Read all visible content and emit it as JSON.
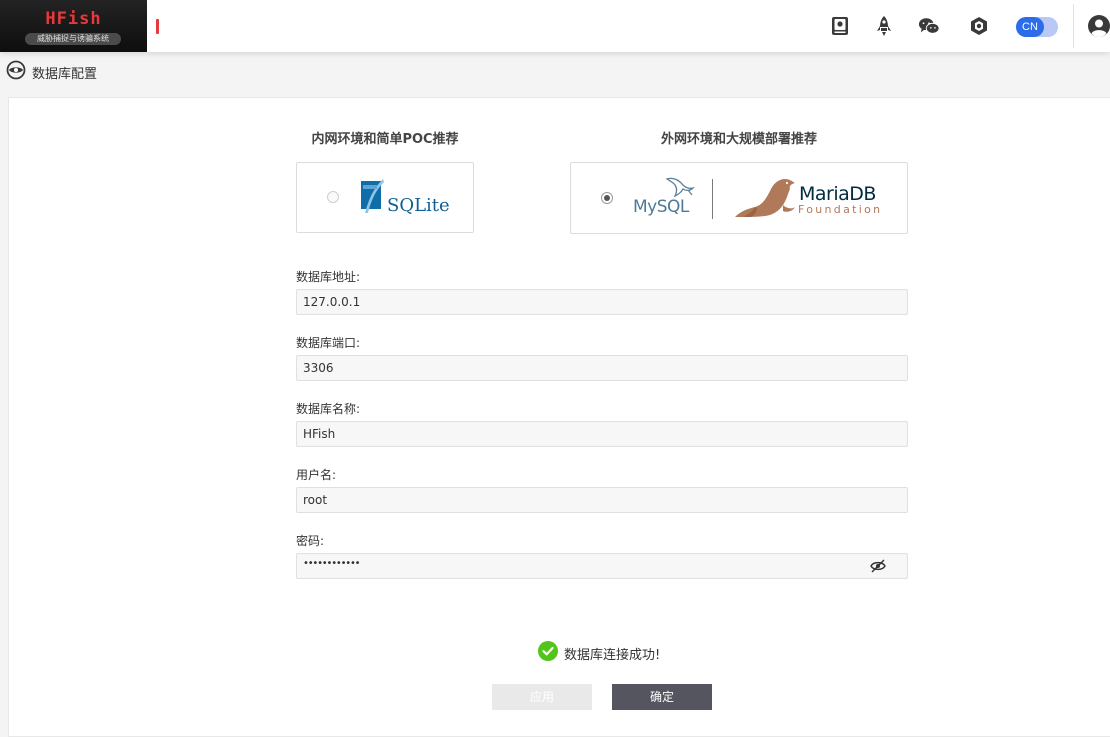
{
  "app": {
    "logo_title": "HFish",
    "logo_subtitle": "威胁捕捉与诱骗系统"
  },
  "topbar": {
    "icons": [
      "book-icon",
      "rocket-icon",
      "wechat-icon",
      "hexagon-icon"
    ],
    "language_label": "CN",
    "avatar_icon": "user-avatar-icon"
  },
  "page": {
    "title": "数据库配置",
    "title_icon": "database-config-icon"
  },
  "db_options": {
    "intranet_title": "内网环境和简单POC推荐",
    "internet_title": "外网环境和大规模部署推荐",
    "sqlite_logo": "SQLite",
    "mysql_logo": "MySQL",
    "mariadb_logo": "MariaDB",
    "mariadb_sub": "Foundation",
    "selected": "mysql"
  },
  "form": {
    "host_label": "数据库地址:",
    "host_value": "127.0.0.1",
    "port_label": "数据库端口:",
    "port_value": "3306",
    "name_label": "数据库名称:",
    "name_value": "HFish",
    "user_label": "用户名:",
    "user_value": "root",
    "password_label": "密码:",
    "password_mask": "••••••••••••"
  },
  "status": {
    "message": "数据库连接成功!",
    "icon": "success-check-icon",
    "color": "#52c41a"
  },
  "buttons": {
    "apply_label": "应用",
    "confirm_label": "确定"
  },
  "colors": {
    "brand_red": "#e8393a",
    "primary_blue": "#2b6de8",
    "button_dark": "#555560"
  }
}
